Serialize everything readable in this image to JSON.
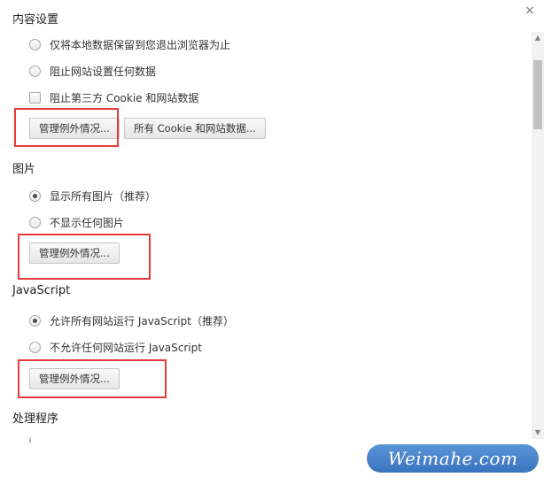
{
  "dialog": {
    "close_label": "×"
  },
  "cookies": {
    "title": "内容设置",
    "options": [
      "仅将本地数据保留到您退出浏览器为止",
      "阻止网站设置任何数据"
    ],
    "block_third_party": "阻止第三方 Cookie 和网站数据",
    "manage_exceptions": "管理例外情况...",
    "all_cookies": "所有 Cookie 和网站数据..."
  },
  "images": {
    "title": "图片",
    "options": [
      "显示所有图片（推荐）",
      "不显示任何图片"
    ],
    "selected_index": 0,
    "manage_exceptions": "管理例外情况..."
  },
  "javascript": {
    "title": "JavaScript",
    "options": [
      "允许所有网站运行 JavaScript（推荐）",
      "不允许任何网站运行 JavaScript"
    ],
    "selected_index": 0,
    "manage_exceptions": "管理例外情况..."
  },
  "handlers": {
    "title": "处理程序"
  },
  "watermark": {
    "text": "Weimahe.com"
  },
  "colors": {
    "highlight": "#e33b3b",
    "watermark_bg": "#4a84cc"
  },
  "icons": {
    "close": "close-icon",
    "scroll_up": "scroll-up-arrow-icon",
    "scroll_down": "scroll-down-arrow-icon"
  }
}
